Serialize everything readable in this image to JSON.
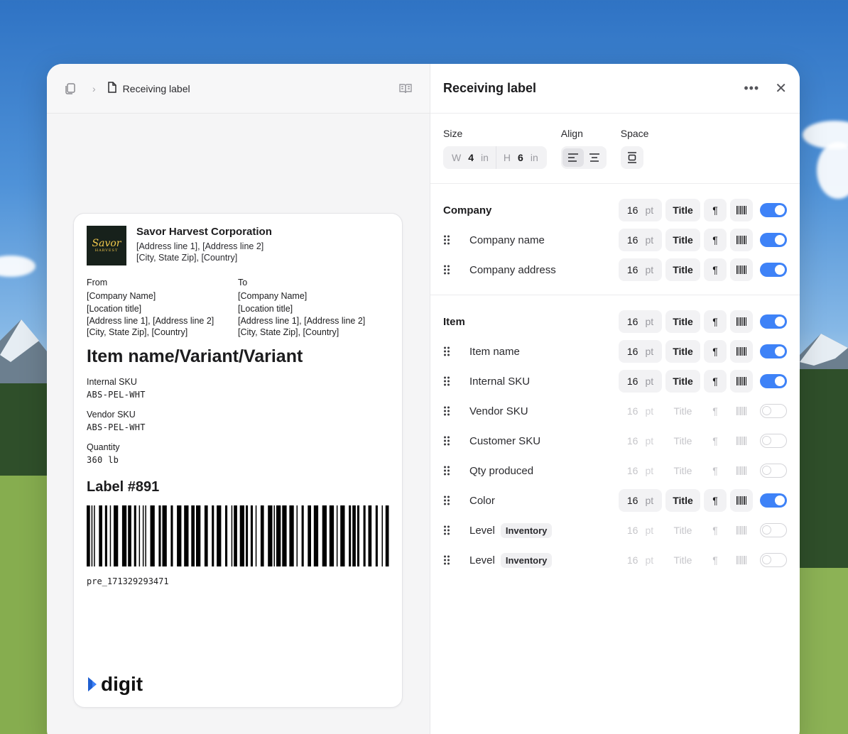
{
  "breadcrumb": {
    "title": "Receiving label"
  },
  "panel": {
    "title": "Receiving label"
  },
  "settings": {
    "size": {
      "caption": "Size",
      "w_label": "W",
      "w_value": "4",
      "w_unit": "in",
      "h_label": "H",
      "h_value": "6",
      "h_unit": "in"
    },
    "align": {
      "caption": "Align",
      "selected": "left"
    },
    "space": {
      "caption": "Space"
    }
  },
  "sections": [
    {
      "header": {
        "label": "Company",
        "size": "16",
        "unit": "pt",
        "style": "Title",
        "enabled": true
      },
      "rows": [
        {
          "label": "Company name",
          "size": "16",
          "unit": "pt",
          "style": "Title",
          "enabled": true
        },
        {
          "label": "Company address",
          "size": "16",
          "unit": "pt",
          "style": "Title",
          "enabled": true
        }
      ]
    },
    {
      "header": {
        "label": "Item",
        "size": "16",
        "unit": "pt",
        "style": "Title",
        "enabled": true
      },
      "rows": [
        {
          "label": "Item name",
          "size": "16",
          "unit": "pt",
          "style": "Title",
          "enabled": true
        },
        {
          "label": "Internal SKU",
          "size": "16",
          "unit": "pt",
          "style": "Title",
          "enabled": true
        },
        {
          "label": "Vendor SKU",
          "size": "16",
          "unit": "pt",
          "style": "Title",
          "enabled": false
        },
        {
          "label": "Customer SKU",
          "size": "16",
          "unit": "pt",
          "style": "Title",
          "enabled": false
        },
        {
          "label": "Qty produced",
          "size": "16",
          "unit": "pt",
          "style": "Title",
          "enabled": false
        },
        {
          "label": "Color",
          "size": "16",
          "unit": "pt",
          "style": "Title",
          "enabled": true
        },
        {
          "label": "Level",
          "badge": "Inventory",
          "size": "16",
          "unit": "pt",
          "style": "Title",
          "enabled": false
        },
        {
          "label": "Level",
          "badge": "Inventory",
          "size": "16",
          "unit": "pt",
          "style": "Title",
          "enabled": false
        }
      ]
    }
  ],
  "label": {
    "logo": {
      "line1": "Savor",
      "line2": "HARVEST"
    },
    "company": "Savor Harvest Corporation",
    "address1": "[Address line 1], [Address line 2]",
    "address2": "[City, State Zip], [Country]",
    "from": {
      "heading": "From",
      "company": "[Company Name]",
      "location": "[Location title]",
      "address1": "[Address line 1], [Address line 2]",
      "address2": "[City, State Zip], [Country]"
    },
    "to": {
      "heading": "To",
      "company": "[Company Name]",
      "location": "[Location title]",
      "address1": "[Address line 1], [Address line 2]",
      "address2": "[City, State Zip], [Country]"
    },
    "item_name": "Item name/Variant/Variant",
    "fields": [
      {
        "key": "Internal SKU",
        "value": "ABS-PEL-WHT"
      },
      {
        "key": "Vendor SKU",
        "value": "ABS-PEL-WHT"
      },
      {
        "key": "Quantity",
        "value": "360 lb"
      }
    ],
    "label_no": "Label #891",
    "barcode_text": "pre_171329293471",
    "brand": "digit"
  },
  "colors": {
    "accent": "#3e82f7"
  }
}
